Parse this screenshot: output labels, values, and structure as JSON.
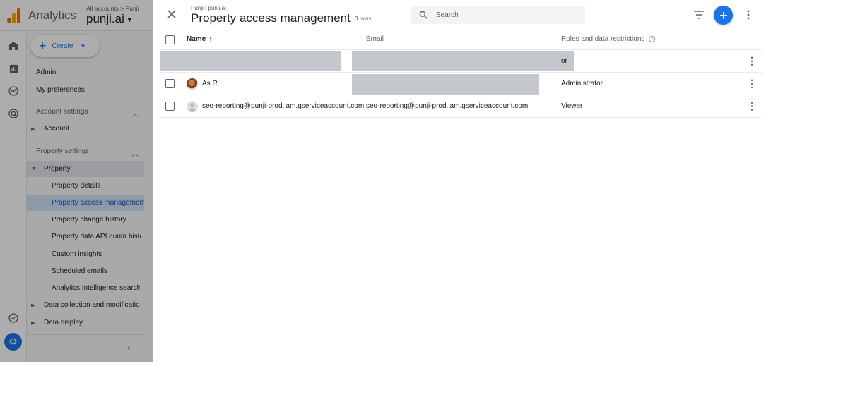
{
  "app": {
    "name": "Analytics",
    "breadcrumb": [
      "All accounts",
      "Punji"
    ],
    "property": "punji.ai"
  },
  "sidebar": {
    "create_label": "Create",
    "admin": "Admin",
    "preferences": "My preferences",
    "account_settings": "Account settings",
    "account": "Account",
    "property_settings": "Property settings",
    "property": "Property",
    "items": [
      "Property details",
      "Property access management",
      "Property change history",
      "Property data API quota history",
      "Custom insights",
      "Scheduled emails",
      "Analytics Intelligence search history"
    ],
    "data_collection": "Data collection and modification",
    "data_display": "Data display"
  },
  "panel": {
    "crumb": "Punji I punji.ai",
    "title": "Property access management",
    "row_count": "3 rows",
    "search_placeholder": "Search"
  },
  "table": {
    "headers": {
      "name": "Name",
      "email": "Email",
      "roles": "Roles and data restrictions"
    },
    "rows": [
      {
        "name": "",
        "email": "",
        "role": "or",
        "redacted": true
      },
      {
        "name": "As R",
        "email": "",
        "role": "Administrator",
        "avatar": "photo"
      },
      {
        "name": "seo-reporting@punji-prod.iam.gserviceaccount.com",
        "email": "seo-reporting@punji-prod.iam.gserviceaccount.com",
        "role": "Viewer",
        "avatar": "generic"
      }
    ]
  },
  "colors": {
    "accent": "#1a73e8",
    "scrim": "rgba(0,0,0,0.32)"
  }
}
